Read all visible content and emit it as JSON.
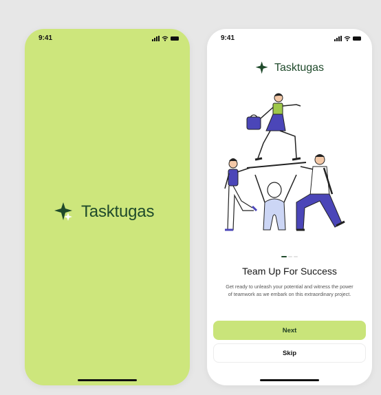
{
  "status_bar": {
    "time": "9:41"
  },
  "brand": {
    "name": "Tasktugas",
    "color": "#1f4a2b",
    "accent": "#cde67c"
  },
  "onboarding": {
    "title": "Team Up For Success",
    "description": "Get ready to unleash your potential and witness the power of teamwork as we embark on this extraordinary project.",
    "pagination": {
      "total": 3,
      "active": 1
    },
    "next_label": "Next",
    "skip_label": "Skip"
  },
  "icons": {
    "logo": "sparkle-star-icon",
    "signal": "cellular-signal-icon",
    "wifi": "wifi-icon",
    "battery": "battery-icon"
  },
  "colors": {
    "illustration_primary": "#4b46b8",
    "illustration_light": "#ccd6f5",
    "illustration_green": "#9fc94a",
    "button_primary": "#c9e47a"
  }
}
